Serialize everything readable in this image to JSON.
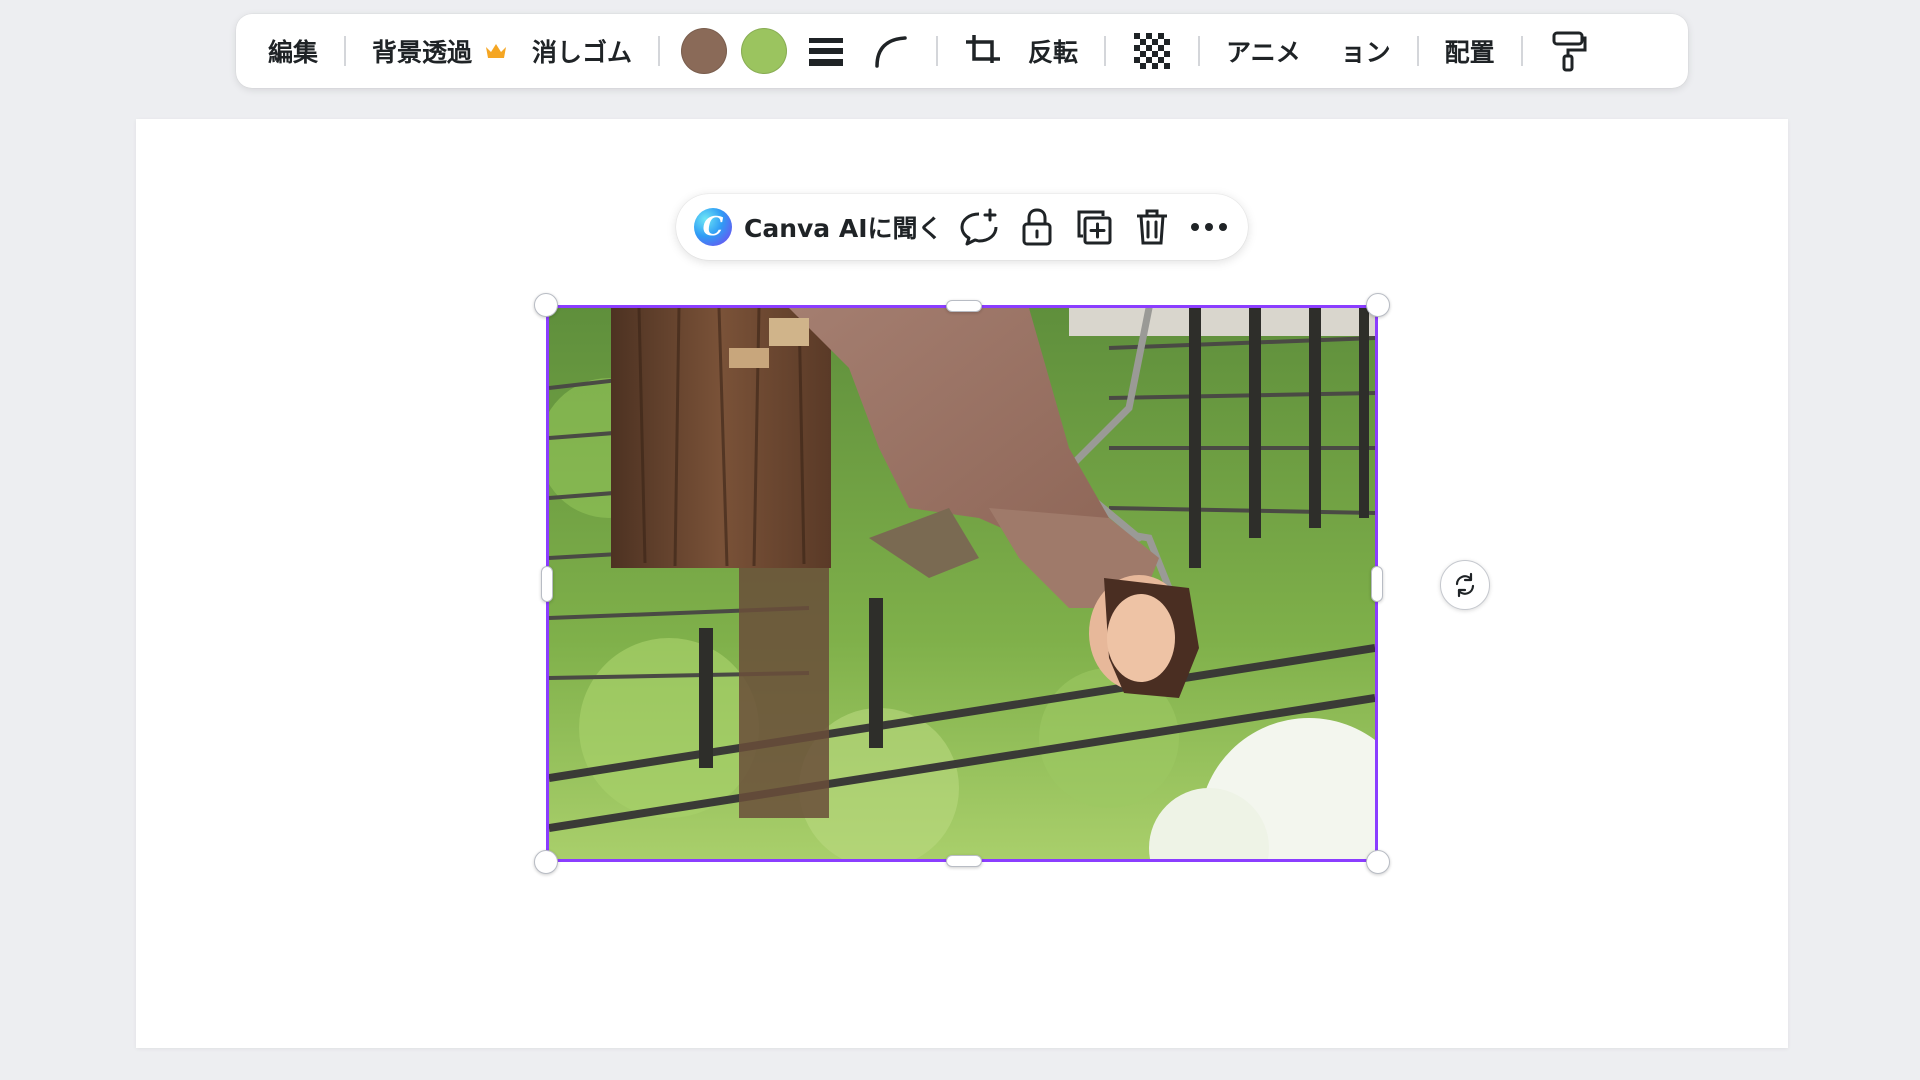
{
  "toolbar": {
    "edit_label": "編集",
    "bg_remove_label": "背景透過",
    "eraser_label": "消しゴム",
    "flip_label": "反転",
    "animate_label": "アニメ",
    "animate_label_tail": "ョン",
    "position_label": "配置",
    "colors": [
      {
        "name": "brown",
        "hex": "#8a6a58"
      },
      {
        "name": "green",
        "hex": "#9bc45f"
      }
    ],
    "icons": [
      "crown-icon",
      "border-lines-icon",
      "corner-rounding-icon",
      "crop-icon",
      "transparency-icon",
      "paint-roller-icon"
    ]
  },
  "context_menu": {
    "ai_label": "Canva AIに聞く",
    "ai_logo_letter": "C",
    "icons": [
      "comment-add-icon",
      "lock-icon",
      "duplicate-icon",
      "trash-icon",
      "more-icon"
    ]
  },
  "colors": {
    "selection": "#8b3dff",
    "canvas": "#ffffff",
    "background": "#edeef1",
    "crown": "#f5a623"
  }
}
